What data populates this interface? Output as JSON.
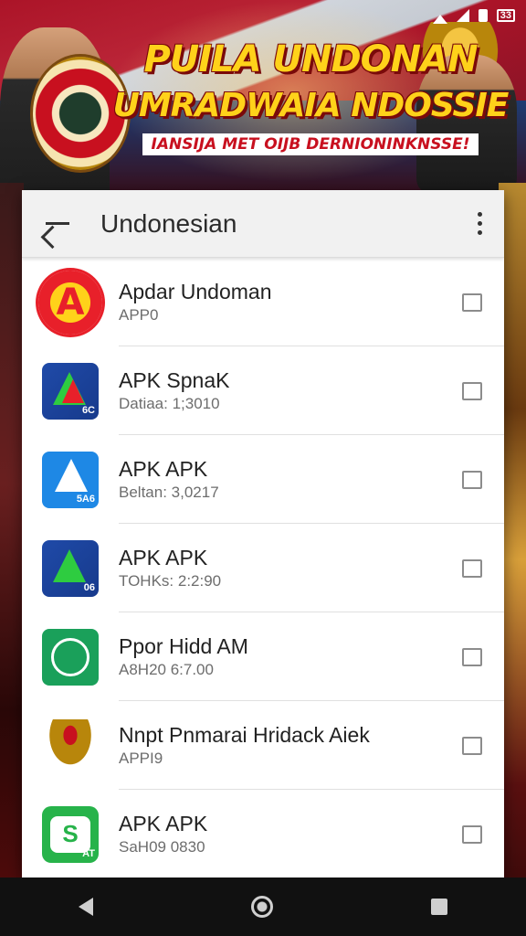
{
  "banner": {
    "line1": "PUILA UNDONAN",
    "line2": "UMRADWAIA NDOSSIE",
    "subtitle": "IANSIJA MET OIJB DERNIONINKNSSE!"
  },
  "statusbar": {
    "battery_label": "33"
  },
  "dialog": {
    "title": "Undonesian",
    "items": [
      {
        "name": "Apdar Undoman",
        "meta": "APP0",
        "icon": "badge-a-icon"
      },
      {
        "name": "APK SpnaK",
        "meta": "Datiaa: 1;3010",
        "icon": "apk-spnak-icon"
      },
      {
        "name": "APK APK",
        "meta": "Beltan: 3,0217",
        "icon": "apk-blue-icon"
      },
      {
        "name": "APK APK",
        "meta": "TOHKs: 2:2:90",
        "icon": "apk-green-icon"
      },
      {
        "name": "Ppor Hidd AM",
        "meta": "A8H20 6:7.00",
        "icon": "dial-icon"
      },
      {
        "name": "Nnpt Pnmarai Hridack Aiek",
        "meta": "APPI9",
        "icon": "garuda-icon"
      },
      {
        "name": "APK APK",
        "meta": "SaH09 0830",
        "icon": "chat-s-icon"
      }
    ]
  },
  "icons_text": {
    "badge": "A",
    "spnak_mini": "6C",
    "apk1_mini": "5A6",
    "apk2_mini": "06",
    "chat": "S",
    "chat_mini": "AT"
  },
  "colors": {
    "accent_red": "#c8101f",
    "banner_yellow": "#ffd21a"
  }
}
